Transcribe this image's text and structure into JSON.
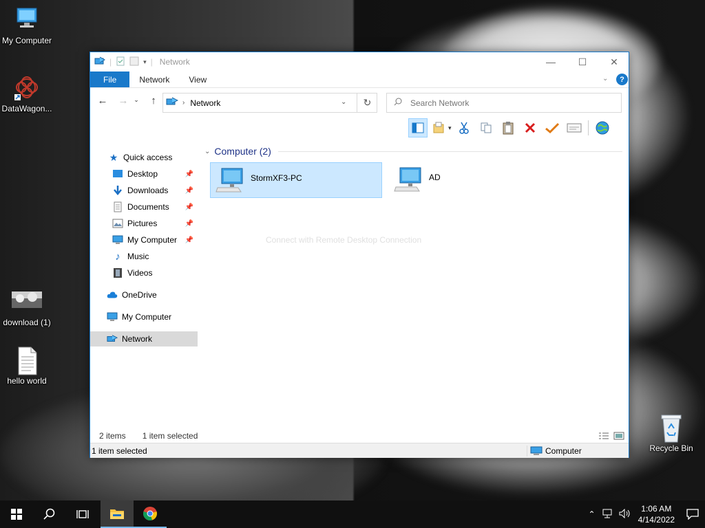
{
  "desktop": {
    "icons": [
      {
        "label": "My Computer"
      },
      {
        "label": "DataWagon..."
      },
      {
        "label": "download (1)"
      },
      {
        "label": "hello world"
      },
      {
        "label": "Recycle Bin"
      }
    ]
  },
  "window": {
    "title": "Network",
    "tabs": {
      "file": "File",
      "network": "Network",
      "view": "View"
    },
    "address": {
      "location": "Network"
    },
    "search": {
      "placeholder": "Search Network"
    },
    "nav": {
      "quick_access": "Quick access",
      "desktop": "Desktop",
      "downloads": "Downloads",
      "documents": "Documents",
      "pictures": "Pictures",
      "my_computer_pinned": "My Computer",
      "music": "Music",
      "videos": "Videos",
      "onedrive": "OneDrive",
      "my_computer": "My Computer",
      "network": "Network"
    },
    "group": {
      "title": "Computer (2)"
    },
    "items": [
      {
        "name": "StormXF3-PC",
        "selected": true
      },
      {
        "name": "AD",
        "selected": false
      }
    ],
    "hint": "Connect with Remote Desktop Connection",
    "status": {
      "item_count": "2 items",
      "selection": "1 item selected",
      "bottom_left": "1 item selected",
      "bottom_right": "Computer"
    }
  },
  "taskbar": {
    "time": "1:06 AM",
    "date": "4/14/2022"
  },
  "colors": {
    "accent": "#1979ca",
    "selection": "#cce8ff",
    "group_title": "#1e3287"
  }
}
